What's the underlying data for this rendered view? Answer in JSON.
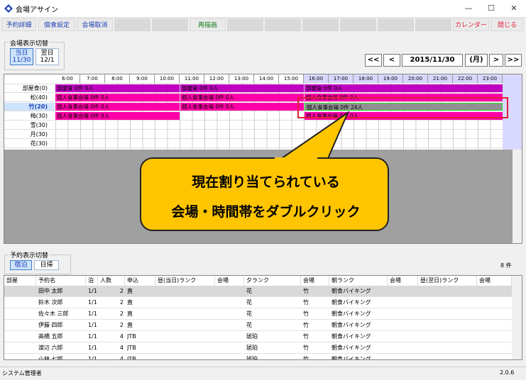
{
  "window": {
    "title": "会場アサイン",
    "minimize": "—",
    "maximize": "☐",
    "close": "✕"
  },
  "toolbar": {
    "left": [
      "予約詳細",
      "個食設定",
      "会場取消"
    ],
    "center": "再描画",
    "calendar": "カレンダー",
    "close": "閉じる"
  },
  "venue_switch": {
    "label": "会場表示切替",
    "tabs": [
      {
        "l1": "当日",
        "l2": "11/30"
      },
      {
        "l1": "翌日",
        "l2": "12/1"
      }
    ]
  },
  "date_nav": {
    "prev_far": "<<",
    "prev": "<",
    "date": "2015/11/30",
    "weekday": "(月)",
    "next": ">",
    "next_far": ">>"
  },
  "hours": [
    "6:00",
    "7:00",
    "8:00",
    "9:00",
    "10:00",
    "11:00",
    "12:00",
    "13:00",
    "14:00",
    "15:00",
    "16:00",
    "17:00",
    "18:00",
    "19:00",
    "20:00",
    "21:00",
    "22:00",
    "23:00"
  ],
  "rooms": [
    "部屋食(0)",
    "松(40)",
    "竹(20)",
    "梅(30)",
    "雪(30)",
    "月(30)",
    "花(30)"
  ],
  "bookings": {
    "room": "部屋食 0件 0人",
    "individual": "個人食事会場 0件 0人",
    "assigned": "個人食事会場 0件 24人"
  },
  "callout": {
    "line1": "現在割り当てられている",
    "line2": "会場・時間帯をダブルクリック"
  },
  "reservation_switch": {
    "label": "予約表示切替",
    "tabs": [
      "宿泊",
      "日帰"
    ],
    "count": "8 件"
  },
  "table": {
    "headers": [
      "部屋",
      "予約名",
      "泊",
      "人数",
      "申込",
      "昼(当日)ランク",
      "会場",
      "夕ランク",
      "会場",
      "朝ランク",
      "会場",
      "昼(翌日)ランク",
      "会場"
    ],
    "rows": [
      {
        "name": "田中 太郎",
        "stay": "1/1",
        "num": "2",
        "apply": "直",
        "dinner": "花",
        "venue": "竹",
        "breakfast": "朝食バイキング"
      },
      {
        "name": "鈴木 次郎",
        "stay": "1/1",
        "num": "2",
        "apply": "直",
        "dinner": "花",
        "venue": "竹",
        "breakfast": "朝食バイキング"
      },
      {
        "name": "佐々木 三郎",
        "stay": "1/1",
        "num": "2",
        "apply": "直",
        "dinner": "花",
        "venue": "竹",
        "breakfast": "朝食バイキング"
      },
      {
        "name": "伊藤 四郎",
        "stay": "1/1",
        "num": "2",
        "apply": "直",
        "dinner": "花",
        "venue": "竹",
        "breakfast": "朝食バイキング"
      },
      {
        "name": "高橋 五郎",
        "stay": "1/1",
        "num": "4",
        "apply": "JTB",
        "dinner": "琥珀",
        "venue": "竹",
        "breakfast": "朝食バイキング"
      },
      {
        "name": "渡辺 六郎",
        "stay": "1/1",
        "num": "4",
        "apply": "JTB",
        "dinner": "琥珀",
        "venue": "竹",
        "breakfast": "朝食バイキング"
      },
      {
        "name": "小林 七郎",
        "stay": "1/1",
        "num": "4",
        "apply": "JTB",
        "dinner": "琥珀",
        "venue": "竹",
        "breakfast": "朝食バイキング"
      }
    ]
  },
  "status": {
    "user": "システム管理者",
    "version": "2.0.6"
  },
  "colors": {
    "purple": "#c000c0",
    "magenta": "#ff00a8",
    "callout": "#ffc500",
    "highlight": "#e0203a"
  }
}
